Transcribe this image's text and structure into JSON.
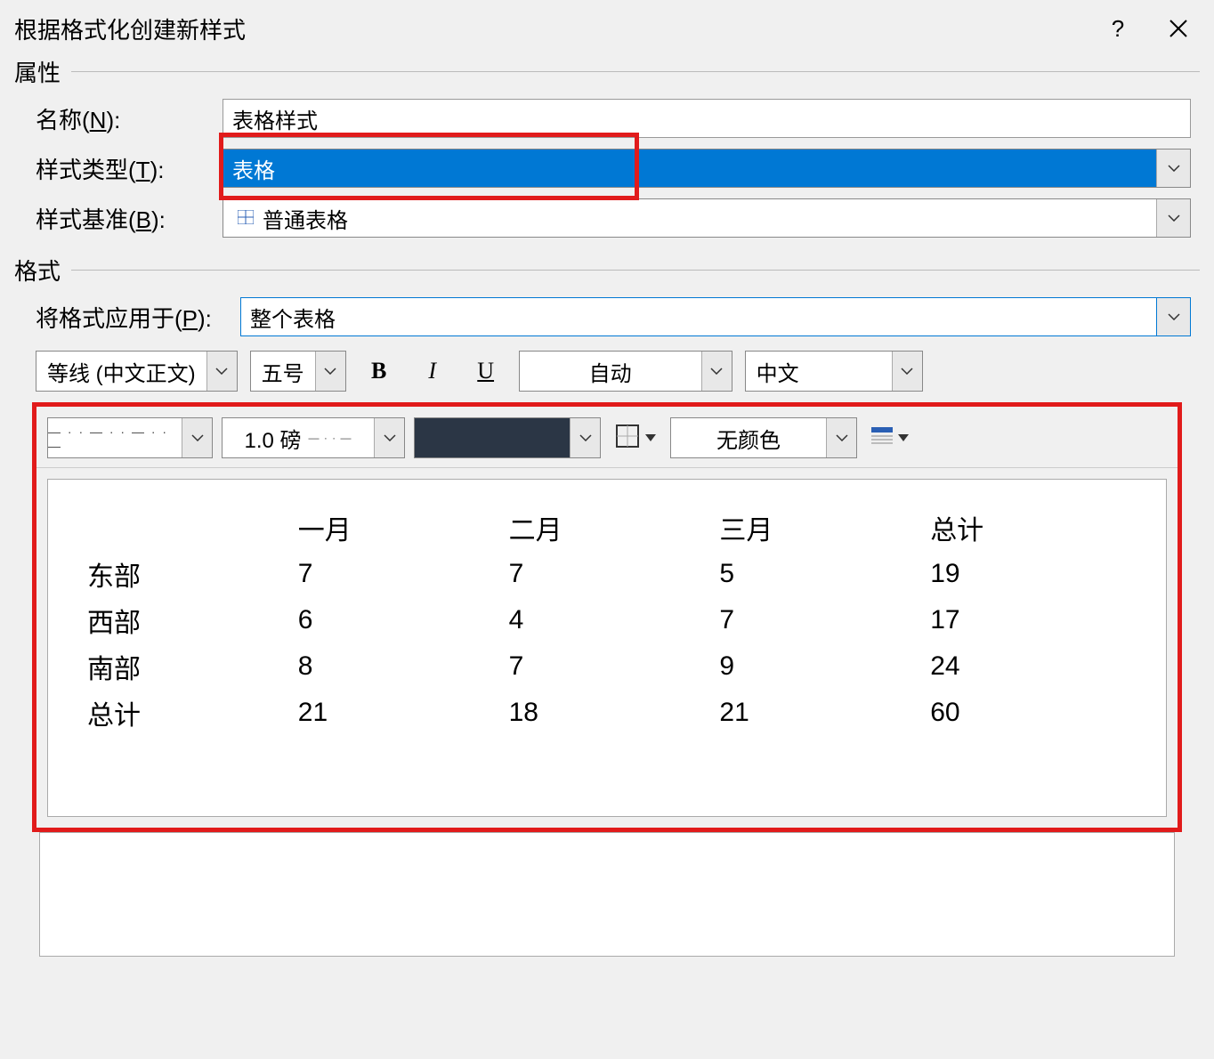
{
  "title": "根据格式化创建新样式",
  "sections": {
    "props": "属性",
    "format": "格式"
  },
  "labels": {
    "name_prefix": "名称(",
    "name_key": "N",
    "name_suffix": "):",
    "type_prefix": "样式类型(",
    "type_key": "T",
    "type_suffix": "):",
    "based_prefix": "样式基准(",
    "based_key": "B",
    "based_suffix": "):",
    "apply_prefix": "将格式应用于(",
    "apply_key": "P",
    "apply_suffix": "):"
  },
  "fields": {
    "name_value": "表格样式",
    "type_value": "表格",
    "based_value": "普通表格",
    "apply_value": "整个表格"
  },
  "toolbar": {
    "font": "等线 (中文正文)",
    "size": "五号",
    "color_label": "自动",
    "lang": "中文",
    "weight": "1.0 磅",
    "fill": "无颜色"
  },
  "preview_table": {
    "headers": [
      "",
      "一月",
      "二月",
      "三月",
      "总计"
    ],
    "rows": [
      [
        "东部",
        "7",
        "7",
        "5",
        "19"
      ],
      [
        "西部",
        "6",
        "4",
        "7",
        "17"
      ],
      [
        "南部",
        "8",
        "7",
        "9",
        "24"
      ],
      [
        "总计",
        "21",
        "18",
        "21",
        "60"
      ]
    ]
  }
}
